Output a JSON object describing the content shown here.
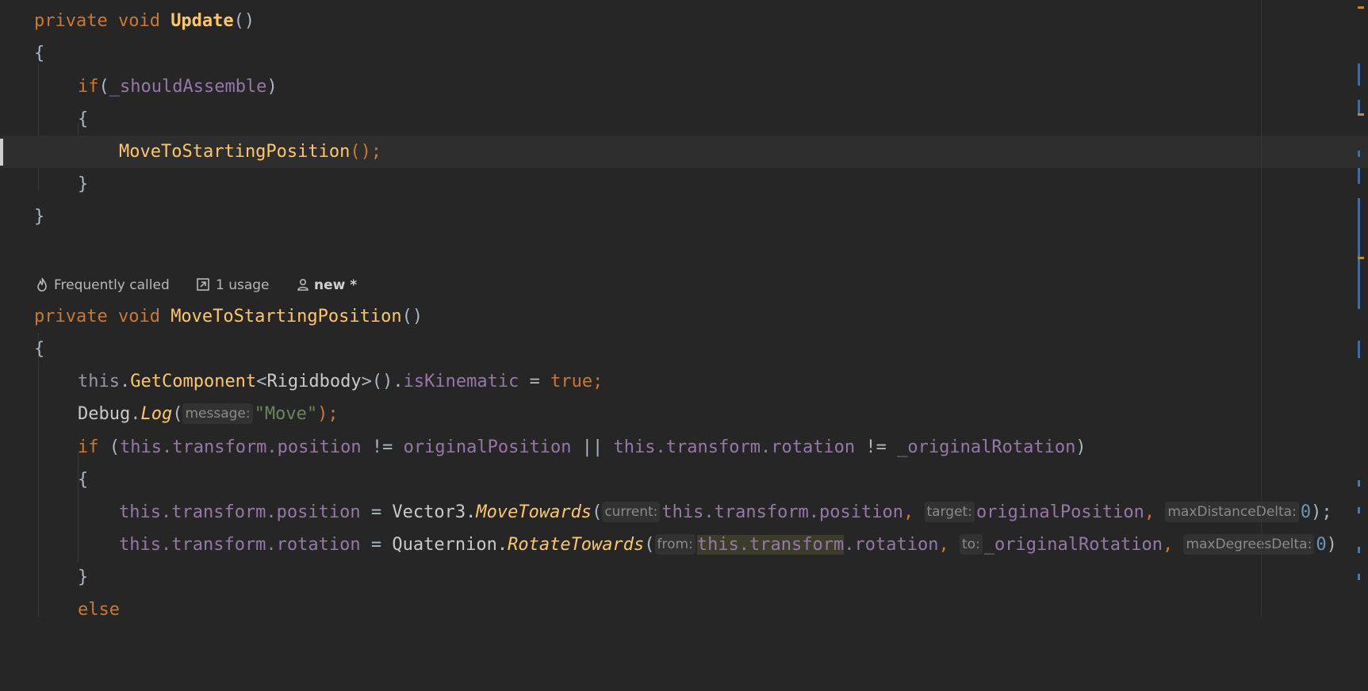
{
  "code": {
    "line1": {
      "kw": "private void ",
      "name": "Update",
      "rest": "()"
    },
    "brace_open": "{",
    "brace_close": "}",
    "line3": {
      "kw": "if",
      "open": "(",
      "field": "_shouldAssemble",
      "close": ")"
    },
    "line5": {
      "call": "MoveToStartingPosition",
      "rest": "();"
    },
    "codevision": {
      "frequently_called": "Frequently called",
      "usages": "1 usage",
      "author": "new *"
    },
    "line9": {
      "kw": "private void ",
      "name": "MoveToStartingPosition",
      "rest": "()"
    },
    "line11": {
      "this": "this",
      "dot1": ".",
      "method": "GetComponent",
      "lt": "<",
      "type": "Rigidbody",
      "gt": ">().",
      "field": "isKinematic",
      "eq": " = ",
      "val": "true",
      "semi": ";"
    },
    "line12": {
      "cls": "Debug",
      "dot": ".",
      "method": "Log",
      "open": "(",
      "hint": "message:",
      "str": "\"Move\"",
      "close": ");"
    },
    "line13": {
      "kw": "if",
      "sp": " (",
      "a": "this.transform.position",
      "op1": " != ",
      "b": "originalPosition",
      "op2": " || ",
      "c": "this.transform.rotation",
      "op3": " != ",
      "d": "_originalRotation",
      "close": ")"
    },
    "line15": {
      "lhs": "this.transform.position",
      "eq": " = ",
      "cls": "Vector3.",
      "method": "MoveTowards",
      "open": "(",
      "hint1": "current:",
      "arg1": "this.transform.position",
      "comma1": ", ",
      "hint2": "target:",
      "arg2": "originalPosition",
      "comma2": ", ",
      "hint3": "maxDistanceDelta:",
      "arg3": "0",
      "close": ");"
    },
    "line16": {
      "lhs": "this.transform.rotation",
      "eq": " = ",
      "cls": "Quaternion.",
      "method": "RotateTowards",
      "open": "(",
      "hint1": "from:",
      "arg1a": "this.transform",
      "arg1b": ".rotation",
      "comma1": ", ",
      "hint2": "to:",
      "arg2": "_originalRotation",
      "comma2": ", ",
      "hint3": "maxDegreesDelta:",
      "arg3": "0",
      "close": ")"
    },
    "line18": {
      "kw": "else"
    }
  },
  "icons": [
    "flame-icon",
    "usages-arrow-icon",
    "person-icon"
  ],
  "colors": {
    "background": "#262626",
    "keyword": "#cc7832",
    "function": "#ffc66d",
    "field": "#9876aa",
    "string": "#6a8759",
    "number": "#6897bb"
  }
}
